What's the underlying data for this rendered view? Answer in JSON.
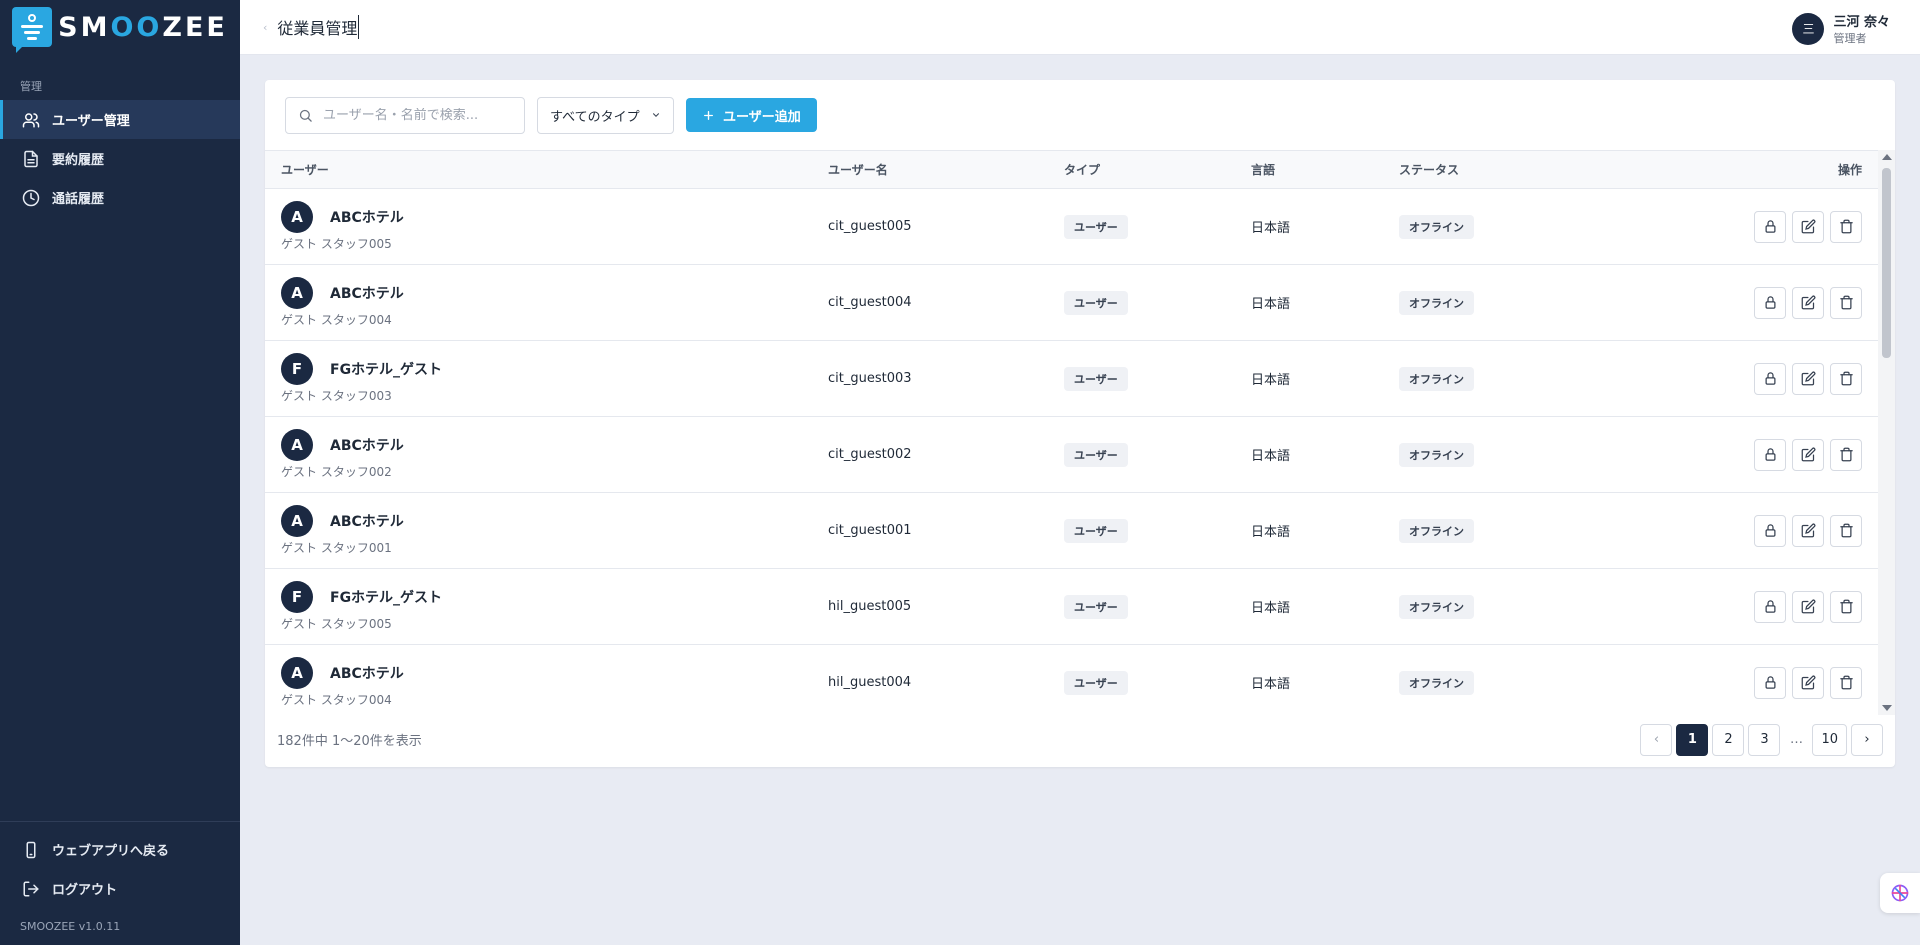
{
  "logo": {
    "text_prefix": "SM",
    "text_oo": "OO",
    "text_suffix": "ZEE"
  },
  "sidebar": {
    "section_label": "管理",
    "items": [
      {
        "label": "ユーザー管理",
        "icon": "users-icon",
        "active": true
      },
      {
        "label": "要約履歴",
        "icon": "document-icon",
        "active": false
      },
      {
        "label": "通話履歴",
        "icon": "clock-icon",
        "active": false
      }
    ],
    "bottom_items": [
      {
        "label": "ウェブアプリへ戻る",
        "icon": "phone-icon"
      },
      {
        "label": "ログアウト",
        "icon": "logout-icon"
      }
    ],
    "version": "SMOOZEE v1.0.11"
  },
  "header": {
    "title": "従業員管理",
    "user": {
      "initial": "三",
      "name": "三河 奈々",
      "role": "管理者"
    }
  },
  "toolbar": {
    "search_placeholder": "ユーザー名・名前で検索...",
    "type_select": "すべてのタイプ",
    "add_button": "ユーザー追加"
  },
  "table": {
    "columns": [
      "ユーザー",
      "ユーザー名",
      "タイプ",
      "言語",
      "ステータス",
      "操作"
    ],
    "rows": [
      {
        "initial": "A",
        "org": "ABCホテル",
        "staff": "ゲスト スタッフ005",
        "username": "cit_guest005",
        "type": "ユーザー",
        "lang": "日本語",
        "status": "オフライン"
      },
      {
        "initial": "A",
        "org": "ABCホテル",
        "staff": "ゲスト スタッフ004",
        "username": "cit_guest004",
        "type": "ユーザー",
        "lang": "日本語",
        "status": "オフライン"
      },
      {
        "initial": "F",
        "org": "FGホテル_ゲスト",
        "staff": "ゲスト スタッフ003",
        "username": "cit_guest003",
        "type": "ユーザー",
        "lang": "日本語",
        "status": "オフライン"
      },
      {
        "initial": "A",
        "org": "ABCホテル",
        "staff": "ゲスト スタッフ002",
        "username": "cit_guest002",
        "type": "ユーザー",
        "lang": "日本語",
        "status": "オフライン"
      },
      {
        "initial": "A",
        "org": "ABCホテル",
        "staff": "ゲスト スタッフ001",
        "username": "cit_guest001",
        "type": "ユーザー",
        "lang": "日本語",
        "status": "オフライン"
      },
      {
        "initial": "F",
        "org": "FGホテル_ゲスト",
        "staff": "ゲスト スタッフ005",
        "username": "hil_guest005",
        "type": "ユーザー",
        "lang": "日本語",
        "status": "オフライン"
      },
      {
        "initial": "A",
        "org": "ABCホテル",
        "staff": "ゲスト スタッフ004",
        "username": "hil_guest004",
        "type": "ユーザー",
        "lang": "日本語",
        "status": "オフライン"
      }
    ]
  },
  "footer": {
    "count_text": "182件中 1〜20件を表示",
    "pages": [
      "1",
      "2",
      "3",
      "…",
      "10"
    ],
    "current_page": "1",
    "prev": "‹",
    "next": "›"
  },
  "colors": {
    "sidebar_bg": "#1b2942",
    "accent": "#2aa7e1",
    "page_bg": "#e8ebf3"
  }
}
